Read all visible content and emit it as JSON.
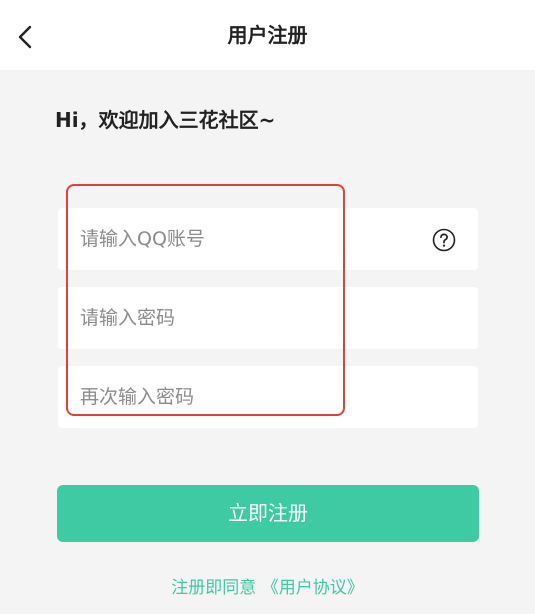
{
  "header": {
    "title": "用户注册",
    "back_icon": "chevron-left-icon"
  },
  "greeting": "Hi，欢迎加入三花社区~",
  "form": {
    "qq_placeholder": "请输入QQ账号",
    "help_icon": "question-circle-icon",
    "password_placeholder": "请输入密码",
    "confirm_password_placeholder": "再次输入密码"
  },
  "register_button_label": "立即注册",
  "agreement": {
    "prefix": "注册即同意",
    "link": "《用户协议》"
  },
  "colors": {
    "accent": "#3ecaa3",
    "highlight_border": "#e0403a",
    "background": "#f4f4f4"
  }
}
